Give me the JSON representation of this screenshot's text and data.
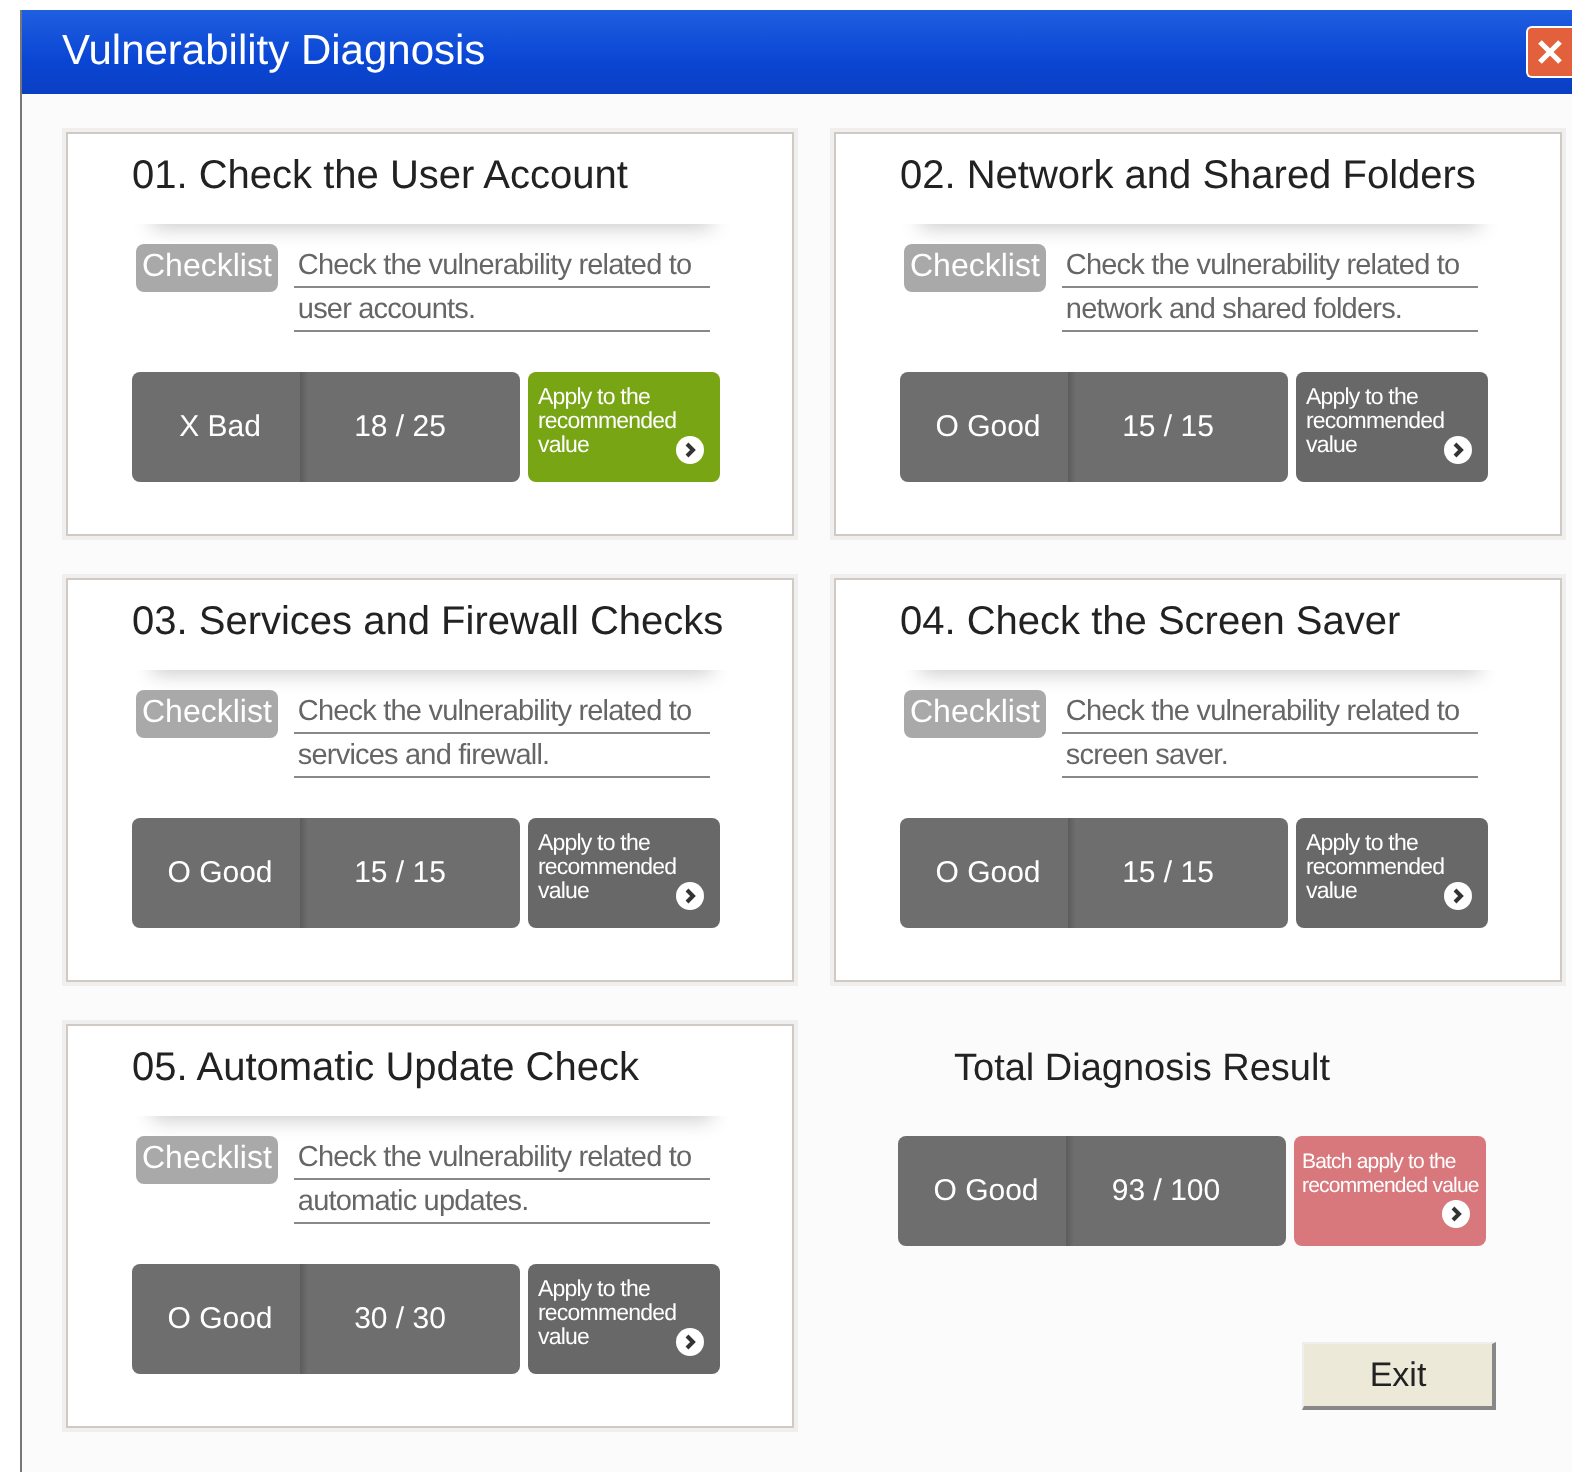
{
  "window": {
    "title": "Vulnerability Diagnosis"
  },
  "checks": [
    {
      "title": "01. Check the User Account",
      "badge": "Checklist",
      "lines": [
        "Check the vulnerability related to",
        "user accounts."
      ],
      "apply_highlighted": true,
      "status_label": "X Bad",
      "score": "18 / 25",
      "apply": "Apply to the recommended value"
    },
    {
      "title": "02. Network and Shared Folders",
      "badge": "Checklist",
      "lines": [
        "Check the vulnerability related to",
        "network and shared folders."
      ],
      "apply_highlighted": false,
      "status_label": "O Good",
      "score": "15 / 15",
      "apply": "Apply to the recommended value"
    },
    {
      "title": "03. Services and Firewall Checks",
      "badge": "Checklist",
      "lines": [
        "Check the vulnerability related to",
        "services and firewall."
      ],
      "apply_highlighted": false,
      "status_label": "O Good",
      "score": "15 / 15",
      "apply": "Apply to the recommended value"
    },
    {
      "title": "04. Check the Screen Saver",
      "badge": "Checklist",
      "lines": [
        "Check the vulnerability related to",
        "screen saver."
      ],
      "apply_highlighted": false,
      "status_label": "O Good",
      "score": "15 / 15",
      "apply": "Apply to the recommended value"
    },
    {
      "title": "05. Automatic Update Check",
      "badge": "Checklist",
      "lines": [
        "Check the vulnerability related to",
        "automatic updates."
      ],
      "apply_highlighted": false,
      "status_label": "O Good",
      "score": "30 / 30",
      "apply": "Apply to the recommended value"
    }
  ],
  "total": {
    "title": "Total Diagnosis Result",
    "status_label": "O Good",
    "score": "93 / 100",
    "apply": "Batch apply to the recommended value"
  },
  "buttons": [
    "Exit"
  ]
}
